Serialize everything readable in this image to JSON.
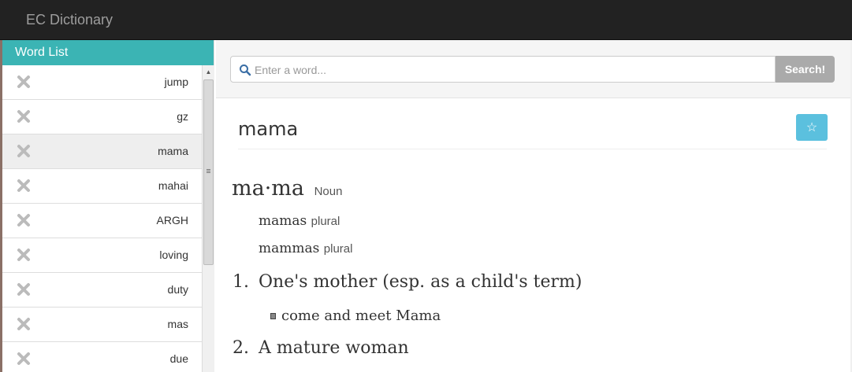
{
  "app": {
    "title": "EC Dictionary"
  },
  "sidebar": {
    "title": "Word List",
    "items": [
      {
        "label": "jump",
        "active": false
      },
      {
        "label": "gz",
        "active": false
      },
      {
        "label": "mama",
        "active": true
      },
      {
        "label": "mahai",
        "active": false
      },
      {
        "label": "ARGH",
        "active": false
      },
      {
        "label": "loving",
        "active": false
      },
      {
        "label": "duty",
        "active": false
      },
      {
        "label": "mas",
        "active": false
      },
      {
        "label": "due",
        "active": false
      }
    ]
  },
  "search": {
    "placeholder": "Enter a word...",
    "value": "",
    "button_label": "Search!"
  },
  "entry": {
    "word": "mama",
    "star_icon": "☆",
    "headword": "ma·ma",
    "part_of_speech": "Noun",
    "forms": [
      {
        "word": "mamas",
        "tag": "plural"
      },
      {
        "word": "mammas",
        "tag": "plural"
      }
    ],
    "definitions": [
      {
        "number": "1.",
        "text": "One's mother (esp. as a child's term)",
        "example": "come and meet Mama"
      },
      {
        "number": "2.",
        "text": "A mature woman"
      }
    ]
  },
  "colors": {
    "navbar": "#222222",
    "sidebar_header": "#3bb4b4",
    "star_button": "#5bc0de",
    "search_button": "#aaaaaa"
  },
  "icons": {
    "delete": "delete-x-icon",
    "search": "magnifier-icon",
    "star": "star-outline-icon"
  }
}
